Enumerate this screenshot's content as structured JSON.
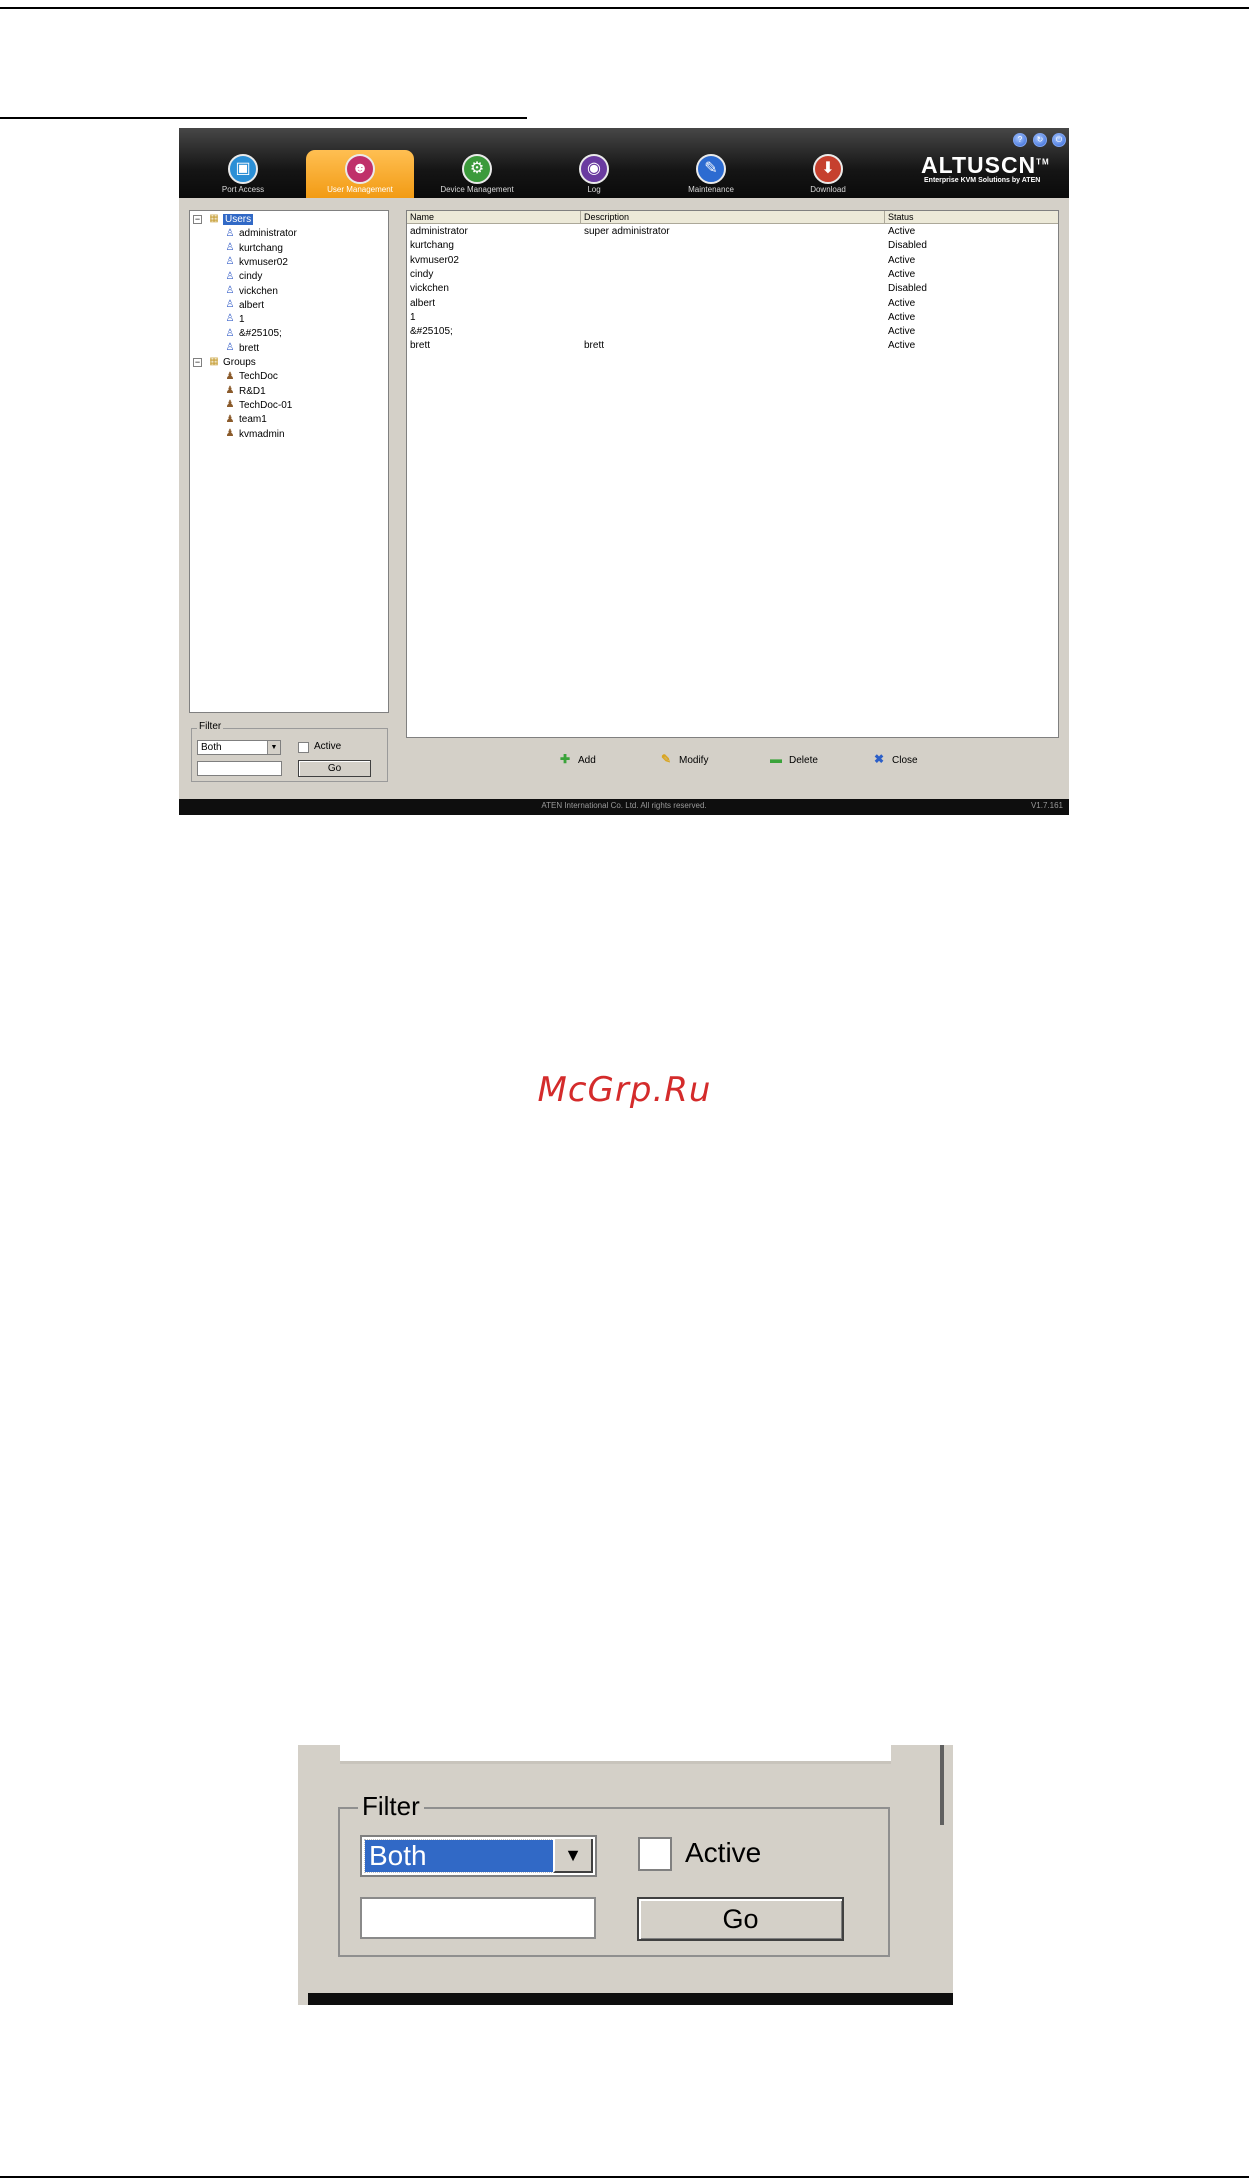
{
  "app": {
    "brand": "ALTUSCN",
    "brand_tm": "TM",
    "brand_sub": "Enterprise KVM Solutions by ATEN",
    "nav": [
      {
        "label": "Port Access",
        "icon": "monitor-icon",
        "glyph": "▣",
        "color": "#2b8fd6"
      },
      {
        "label": "User Management",
        "icon": "users-icon",
        "glyph": "☻",
        "color": "#c0306a"
      },
      {
        "label": "Device Management",
        "icon": "device-icon",
        "glyph": "⚙",
        "color": "#3b9a3b"
      },
      {
        "label": "Log",
        "icon": "log-icon",
        "glyph": "◉",
        "color": "#6a3ba0"
      },
      {
        "label": "Maintenance",
        "icon": "maintenance-icon",
        "glyph": "✎",
        "color": "#2c6bd1"
      },
      {
        "label": "Download",
        "icon": "download-icon",
        "glyph": "⬇",
        "color": "#c6402e"
      }
    ],
    "active_nav": "User Management",
    "accent_color": "#f29b14",
    "tree": {
      "users_label": "Users",
      "users": [
        "administrator",
        "kurtchang",
        "kvmuser02",
        "cindy",
        "vickchen",
        "albert",
        "1",
        "&#25105;",
        "brett"
      ],
      "groups_label": "Groups",
      "groups": [
        "TechDoc",
        "R&D1",
        "TechDoc-01",
        "team1",
        "kvmadmin"
      ]
    },
    "filter": {
      "legend": "Filter",
      "select_value": "Both",
      "active_label": "Active",
      "go_label": "Go"
    },
    "list": {
      "columns": [
        "Name",
        "Description",
        "Status"
      ],
      "rows": [
        [
          "administrator",
          "super administrator",
          "Active"
        ],
        [
          "kurtchang",
          "",
          "Disabled"
        ],
        [
          "kvmuser02",
          "",
          "Active"
        ],
        [
          "cindy",
          "",
          "Active"
        ],
        [
          "vickchen",
          "",
          "Disabled"
        ],
        [
          "albert",
          "",
          "Active"
        ],
        [
          "1",
          "",
          "Active"
        ],
        [
          "&#25105;",
          "",
          "Active"
        ],
        [
          "brett",
          "brett",
          "Active"
        ]
      ]
    },
    "actions": {
      "add": "Add",
      "modify": "Modify",
      "delete": "Delete",
      "close": "Close"
    },
    "footer": {
      "copyright": "ATEN International Co. Ltd. All rights reserved.",
      "version": "V1.7.161"
    }
  },
  "watermark": "McGrp.Ru",
  "zoom_filter": {
    "legend": "Filter",
    "select_value": "Both",
    "active_label": "Active",
    "go_label": "Go"
  }
}
